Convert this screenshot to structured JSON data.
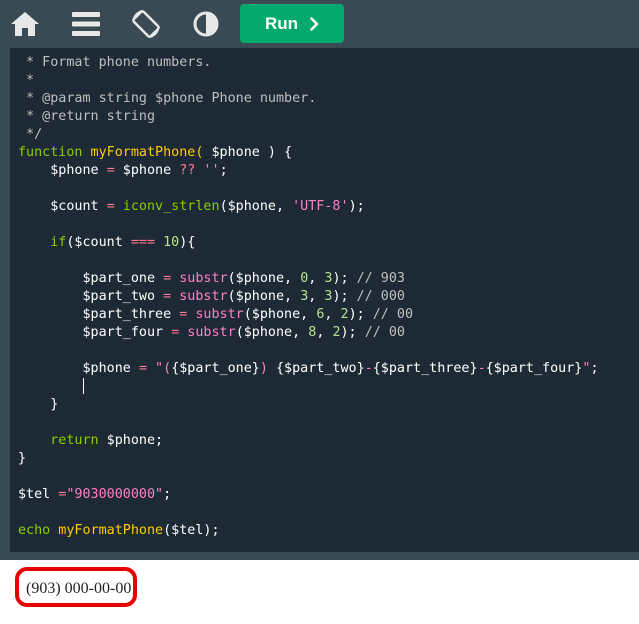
{
  "toolbar": {
    "icons": [
      "home-icon",
      "menu-icon",
      "rotate-layout-icon",
      "contrast-icon"
    ],
    "run_label": "Run",
    "run_icon": "chevron-right-icon",
    "bg_color": "#3a4a54",
    "run_color": "#04aa6d"
  },
  "editor": {
    "bg_color": "#1d2a35",
    "lines": [
      [
        {
          "t": " * Format phone numbers.",
          "c": "comment"
        }
      ],
      [
        {
          "t": " *",
          "c": "comment"
        }
      ],
      [
        {
          "t": " * @param string $phone Phone number.",
          "c": "comment"
        }
      ],
      [
        {
          "t": " * @return string",
          "c": "comment"
        }
      ],
      [
        {
          "t": " */",
          "c": "comment"
        }
      ],
      [
        {
          "t": "function",
          "c": "kw"
        },
        {
          "t": " myFormatPhone( ",
          "c": "fn"
        },
        {
          "t": "$phone",
          "c": "var"
        },
        {
          "t": " ) {",
          "c": "var"
        }
      ],
      [
        {
          "t": "    $phone ",
          "c": "var"
        },
        {
          "t": "=",
          "c": "op"
        },
        {
          "t": " $phone ",
          "c": "var"
        },
        {
          "t": "??",
          "c": "op"
        },
        {
          "t": " ''",
          "c": "str"
        },
        {
          "t": ";",
          "c": "var"
        }
      ],
      [],
      [
        {
          "t": "    $count ",
          "c": "var"
        },
        {
          "t": "=",
          "c": "op"
        },
        {
          "t": " iconv_strlen",
          "c": "kw"
        },
        {
          "t": "($phone, ",
          "c": "var"
        },
        {
          "t": "'UTF-8'",
          "c": "str"
        },
        {
          "t": ");",
          "c": "var"
        }
      ],
      [],
      [
        {
          "t": "    ",
          "c": "var"
        },
        {
          "t": "if",
          "c": "kw"
        },
        {
          "t": "($count ",
          "c": "var"
        },
        {
          "t": "===",
          "c": "op"
        },
        {
          "t": " 10",
          "c": "num"
        },
        {
          "t": "){",
          "c": "var"
        }
      ],
      [],
      [
        {
          "t": "        $part_one ",
          "c": "var"
        },
        {
          "t": "=",
          "c": "op"
        },
        {
          "t": " substr",
          "c": "str"
        },
        {
          "t": "($phone, ",
          "c": "var"
        },
        {
          "t": "0",
          "c": "num"
        },
        {
          "t": ", ",
          "c": "var"
        },
        {
          "t": "3",
          "c": "num"
        },
        {
          "t": "); ",
          "c": "var"
        },
        {
          "t": "// 903",
          "c": "comment"
        }
      ],
      [
        {
          "t": "        $part_two ",
          "c": "var"
        },
        {
          "t": "=",
          "c": "op"
        },
        {
          "t": " substr",
          "c": "str"
        },
        {
          "t": "($phone, ",
          "c": "var"
        },
        {
          "t": "3",
          "c": "num"
        },
        {
          "t": ", ",
          "c": "var"
        },
        {
          "t": "3",
          "c": "num"
        },
        {
          "t": "); ",
          "c": "var"
        },
        {
          "t": "// 000",
          "c": "comment"
        }
      ],
      [
        {
          "t": "        $part_three ",
          "c": "var"
        },
        {
          "t": "=",
          "c": "op"
        },
        {
          "t": " substr",
          "c": "str"
        },
        {
          "t": "($phone, ",
          "c": "var"
        },
        {
          "t": "6",
          "c": "num"
        },
        {
          "t": ", ",
          "c": "var"
        },
        {
          "t": "2",
          "c": "num"
        },
        {
          "t": "); ",
          "c": "var"
        },
        {
          "t": "// 00",
          "c": "comment"
        }
      ],
      [
        {
          "t": "        $part_four ",
          "c": "var"
        },
        {
          "t": "=",
          "c": "op"
        },
        {
          "t": " substr",
          "c": "str"
        },
        {
          "t": "($phone, ",
          "c": "var"
        },
        {
          "t": "8",
          "c": "num"
        },
        {
          "t": ", ",
          "c": "var"
        },
        {
          "t": "2",
          "c": "num"
        },
        {
          "t": "); ",
          "c": "var"
        },
        {
          "t": "// 00",
          "c": "comment"
        }
      ],
      [],
      [
        {
          "t": "        $phone ",
          "c": "var"
        },
        {
          "t": "=",
          "c": "op"
        },
        {
          "t": " \"(",
          "c": "str"
        },
        {
          "t": "{$part_one}",
          "c": "var"
        },
        {
          "t": ") ",
          "c": "str"
        },
        {
          "t": "{$part_two}",
          "c": "var"
        },
        {
          "t": "-",
          "c": "str"
        },
        {
          "t": "{$part_three}",
          "c": "var"
        },
        {
          "t": "-",
          "c": "str"
        },
        {
          "t": "{$part_four}",
          "c": "var"
        },
        {
          "t": "\"",
          "c": "str"
        },
        {
          "t": ";",
          "c": "var"
        }
      ],
      [
        {
          "t": "        ",
          "c": "var"
        },
        {
          "t": "",
          "c": "cursor"
        }
      ],
      [
        {
          "t": "    }",
          "c": "var"
        }
      ],
      [],
      [
        {
          "t": "    ",
          "c": "var"
        },
        {
          "t": "return",
          "c": "kw"
        },
        {
          "t": " $phone;",
          "c": "var"
        }
      ],
      [
        {
          "t": "}",
          "c": "var"
        }
      ],
      [],
      [
        {
          "t": "$tel ",
          "c": "var"
        },
        {
          "t": "=",
          "c": "op"
        },
        {
          "t": "\"9030000000\"",
          "c": "str"
        },
        {
          "t": ";",
          "c": "var"
        }
      ],
      [],
      [
        {
          "t": "echo",
          "c": "kw"
        },
        {
          "t": " myFormatPhone",
          "c": "fn"
        },
        {
          "t": "($tel);",
          "c": "var"
        }
      ]
    ]
  },
  "output": {
    "result_text": "(903) 000-00-00",
    "highlight_color": "#e60000"
  }
}
